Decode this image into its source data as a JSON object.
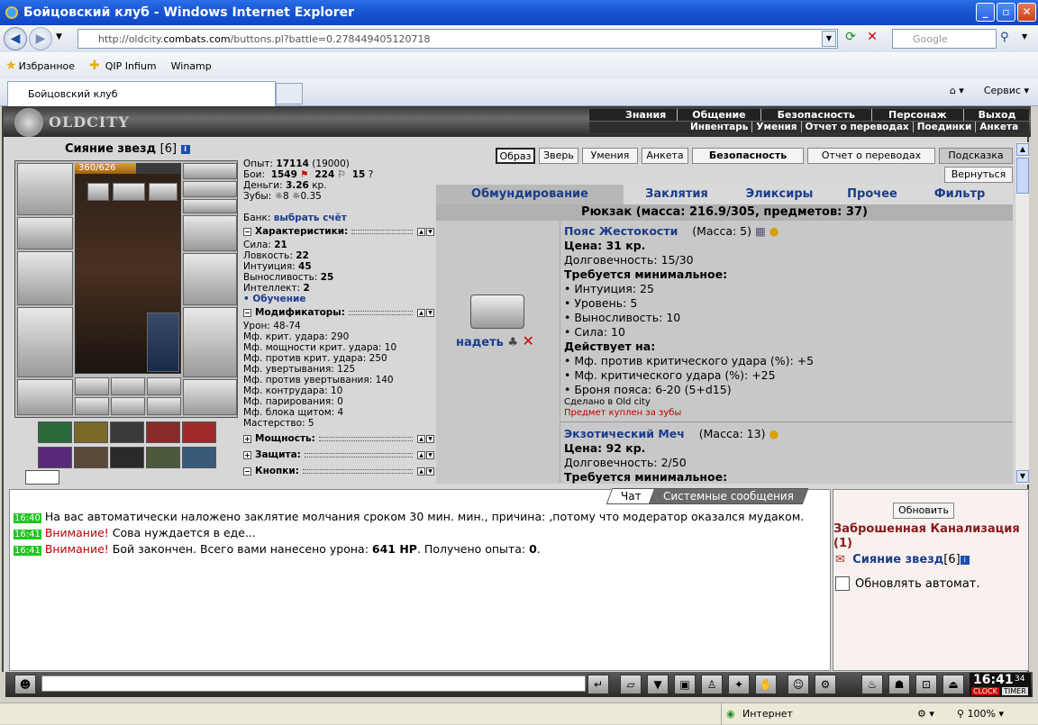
{
  "window": {
    "title": "Бойцовский клуб - Windows Internet Explorer"
  },
  "address": {
    "url_prefix": "http://oldcity.",
    "url_domain": "combats.com",
    "url_suffix": "/buttons.pl?battle=0.278449405120718",
    "search_placeholder": "Google"
  },
  "favorites": {
    "label": "Избранное",
    "items": [
      "QIP Infium",
      "Winamp"
    ]
  },
  "tab": {
    "title": "Бойцовский клуб",
    "tools": "Сервис"
  },
  "game": {
    "logo": "OLDCITY",
    "top_nav_1": [
      "Знания",
      "Общение",
      "Безопасность",
      "Персонаж",
      "Выход"
    ],
    "top_nav_2": [
      "Инвентарь",
      "Умения",
      "Отчет о переводах",
      "Поединки",
      "Анкета"
    ],
    "character": {
      "name": "Сияние звезд",
      "level": "[6]",
      "hp": "360/626",
      "hp_fraction": 0.575
    },
    "stats": {
      "exp_label": "Опыт:",
      "exp": "17114",
      "exp_next": "(19000)",
      "fights_label": "Бои:",
      "wins": "1549",
      "losses": "224",
      "draws": "15",
      "money_label": "Деньги:",
      "money": "3.26",
      "money_unit": "кр.",
      "teeth_label": "Зубы:",
      "teeth": "8",
      "teeth2": "0.35",
      "bank_label": "Банк:",
      "bank_link": "выбрать счёт",
      "chars_head": "Характеристики:",
      "attrs": [
        {
          "label": "Сила:",
          "value": "21"
        },
        {
          "label": "Ловкость:",
          "value": "22"
        },
        {
          "label": "Интуиция:",
          "value": "45"
        },
        {
          "label": "Выносливость:",
          "value": "25"
        },
        {
          "label": "Интеллект:",
          "value": "2"
        }
      ],
      "training": "• Обучение",
      "mods_head": "Модификаторы:",
      "mods": [
        "Урон: 48-74",
        "Мф. крит. удара: 290",
        "Мф. мощности крит. удара: 10",
        "Мф. против крит. удара: 250",
        "Мф. увертывания: 125",
        "Мф. против увертывания: 140",
        "Мф. контрудара: 10",
        "Мф. парирования: 0",
        "Мф. блока щитом: 4",
        "Мастерство: 5"
      ],
      "power_head": "Мощность:",
      "defense_head": "Защита:",
      "buttons_head": "Кнопки:"
    },
    "top_buttons": [
      "Образ",
      "Зверь",
      "Умения",
      "Анкета",
      "Безопасность",
      "Отчет о переводах",
      "Подсказка",
      "Вернуться"
    ],
    "inv_tabs": [
      "Обмундирование",
      "Заклятия",
      "Эликсиры",
      "Прочее",
      "Фильтр"
    ],
    "rucksack": "Рюкзак (масса: 216.9/305, предметов: 37)",
    "items": [
      {
        "name": "Пояс Жестокости",
        "mass": "(Масса: 5)",
        "price": "Цена: 31 кр.",
        "durability": "Долговечность: 15/30",
        "req_head": "Требуется минимальное:",
        "reqs": [
          "• Интуиция: 25",
          "• Уровень: 5",
          "• Выносливость: 10",
          "• Сила: 10"
        ],
        "effects_head": "Действует на:",
        "effects": [
          "• Мф. против критического удара (%): +5",
          "• Мф. критического удара (%): +25",
          "• Броня пояса: 6-20 (5+d15)"
        ],
        "made": "Сделано в Old city",
        "bought": "Предмет куплен за зубы",
        "action": "надеть"
      },
      {
        "name": "Экзотический Меч",
        "mass": "(Масса: 13)",
        "price": "Цена: 92 кр.",
        "durability": "Долговечность: 2/50",
        "req_head": "Требуется минимальное:"
      }
    ],
    "chat": {
      "tabs": [
        "Чат",
        "Системные сообщения"
      ],
      "lines": [
        {
          "time": "16:40",
          "warn": "",
          "text": "На вас автоматически наложено заклятие молчания сроком 30 мин. мин., причина: ,потому что модератор оказался мудаком."
        },
        {
          "time": "16:41",
          "warn": "Внимание!",
          "text": "Сова нуждается в еде..."
        },
        {
          "time": "16:41",
          "warn": "Внимание!",
          "text_pre": "Бой закончен. Всего вами нанесено урона:",
          "hp": "641 HP",
          "text_mid": ". Получено опыта:",
          "exp": "0",
          "text_end": "."
        }
      ]
    },
    "right": {
      "refresh": "Обновить",
      "location": "Заброшенная Канализация",
      "count": "(1)",
      "user": "Сияние звезд",
      "user_level": "[6]",
      "auto": "Обновлять автомат."
    },
    "clock": {
      "time": "16:41",
      "sec": "34",
      "label1": "CLOCK",
      "label2": "TIMER"
    }
  },
  "status": {
    "zone": "Интернет",
    "zoom": "100%"
  }
}
